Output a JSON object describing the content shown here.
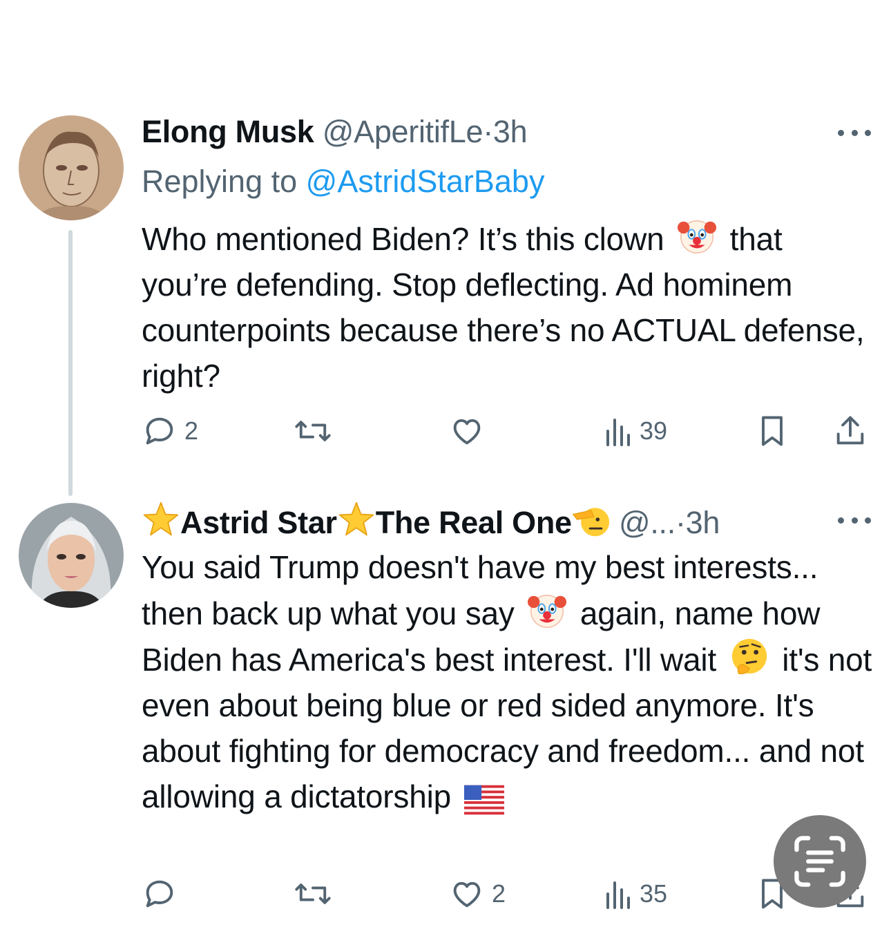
{
  "tweets": [
    {
      "name": "Elong Musk",
      "handle": "@AperitifLe",
      "dot": "·",
      "time": "3h",
      "replying_prefix": "Replying to ",
      "replying_mention": "@AstridStarBaby",
      "text_part1": "Who mentioned Biden? It’s this clown",
      "text_part2": "that you’re defending. Stop deflecting. Ad hominem counterpoints because there’s no ACTUAL defense, right?",
      "emoji_1": "clown-face",
      "actions": {
        "reply_count": "2",
        "retweet_count": "",
        "like_count": "",
        "views_count": "39"
      }
    },
    {
      "name_part1": "Astrid Star",
      "name_part2": "The Real One",
      "name_emojis": [
        "star",
        "star",
        "saluting-face"
      ],
      "handle": "@...",
      "dot": "·",
      "time": "3h",
      "text_part1": "You said Trump doesn't have my best interests... then back up what you say",
      "text_part2": "again, name how Biden has America's best interest. I'll wait",
      "text_part3": "it's not even about being blue or red sided anymore. It's about fighting for democracy and freedom... and not allowing a dictatorship",
      "inline_emojis": [
        "clown-face",
        "thinking-face",
        "us-flag"
      ],
      "actions": {
        "reply_count": "",
        "retweet_count": "",
        "like_count": "2",
        "views_count": "35"
      }
    }
  ],
  "colors": {
    "text": "#0f1419",
    "secondary": "#536471",
    "link": "#1d9bf0",
    "thread_line": "#cfd9de",
    "fab": "#7a7a7a"
  },
  "floating_button_icon": "text-scan-icon"
}
